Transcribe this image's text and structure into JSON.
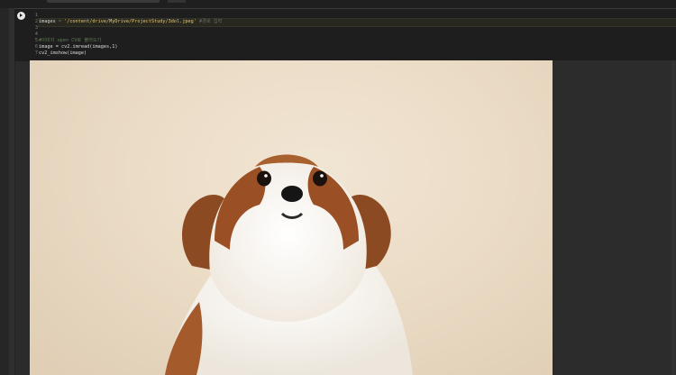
{
  "code": {
    "lines": [
      {
        "no": "1",
        "code": ""
      },
      {
        "no": "2",
        "var": "images",
        "eq": " = ",
        "str": "'/content/drive/MyDrive/ProjectStudy/3dol.jpeg'",
        "hint": " #경로 입력"
      },
      {
        "no": "3",
        "code": ""
      },
      {
        "no": "4",
        "code": ""
      },
      {
        "no": "5",
        "comment": "#이미지 open CV로 불러오기"
      },
      {
        "no": "6",
        "code": "image = cv2.imread(images,1)"
      },
      {
        "no": "7",
        "code": "cv2_imshow(image)"
      }
    ]
  },
  "output": {
    "image_subject": "Shih Tzu puppy portrait on beige background"
  },
  "colors": {
    "editor_bg": "#1e1e1e",
    "string": "#e8c879",
    "backdrop": "#ebdcc6",
    "fur_brown": "#9a4f24",
    "fur_white": "#f7f4ef"
  }
}
